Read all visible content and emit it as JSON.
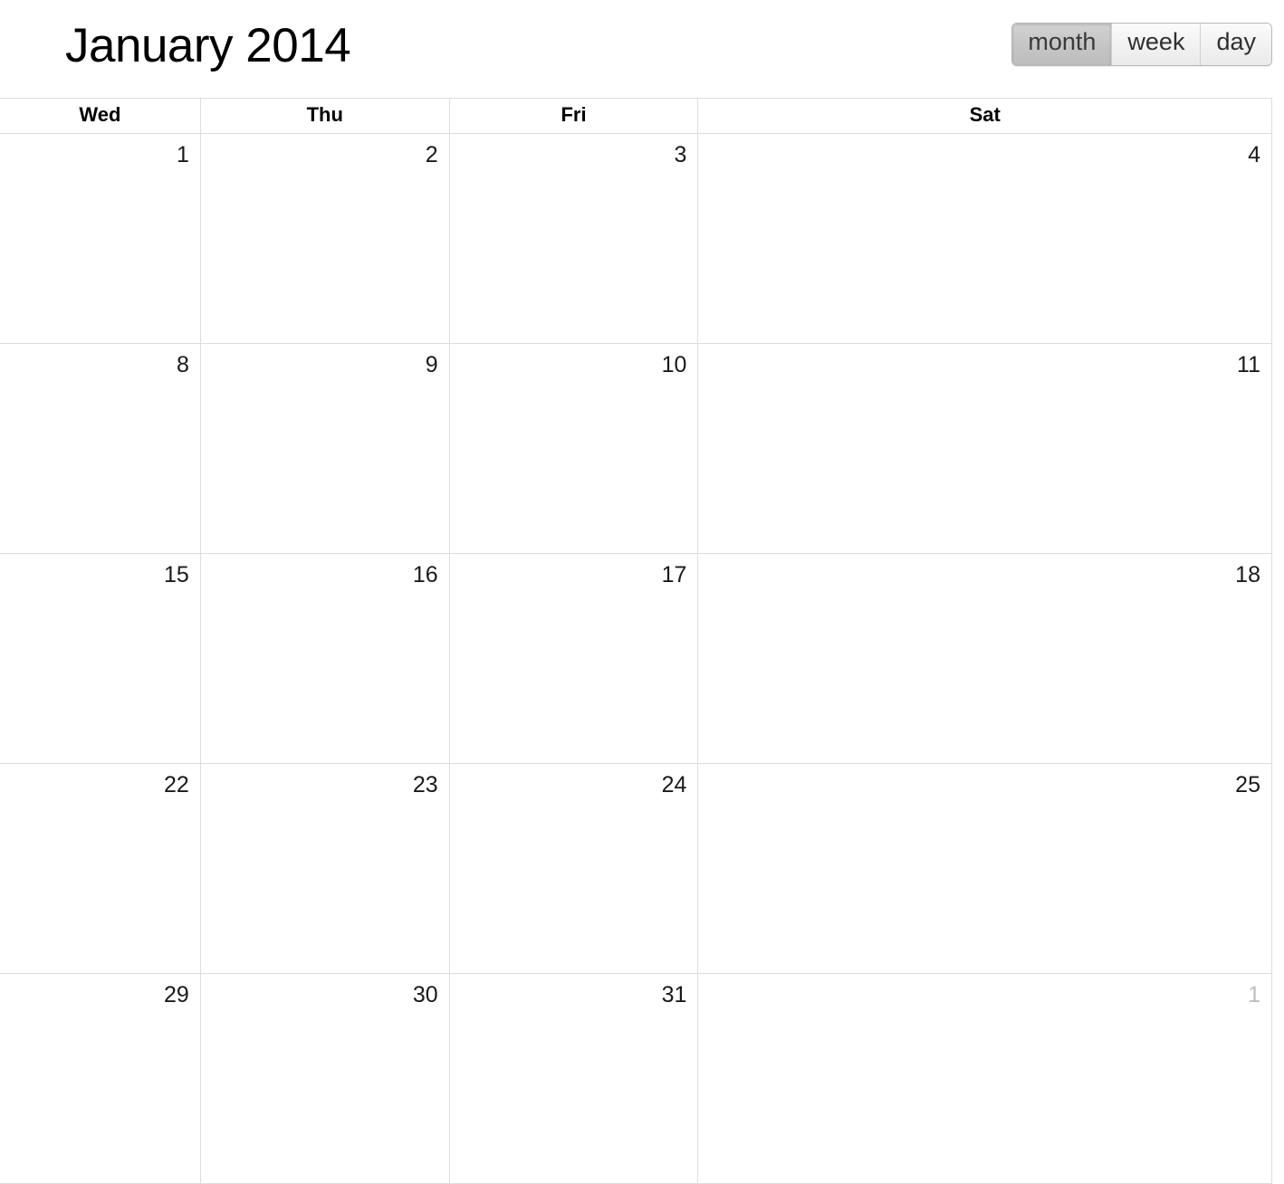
{
  "header": {
    "title": "January 2014"
  },
  "view_switcher": {
    "buttons": [
      {
        "label": "month",
        "active": true
      },
      {
        "label": "week",
        "active": false
      },
      {
        "label": "day",
        "active": false
      }
    ]
  },
  "calendar": {
    "columns": [
      "Wed",
      "Thu",
      "Fri",
      "Sat"
    ],
    "weeks": [
      [
        {
          "day": "1",
          "other_month": false
        },
        {
          "day": "2",
          "other_month": false
        },
        {
          "day": "3",
          "other_month": false
        },
        {
          "day": "4",
          "other_month": false
        }
      ],
      [
        {
          "day": "8",
          "other_month": false
        },
        {
          "day": "9",
          "other_month": false
        },
        {
          "day": "10",
          "other_month": false
        },
        {
          "day": "11",
          "other_month": false
        }
      ],
      [
        {
          "day": "15",
          "other_month": false
        },
        {
          "day": "16",
          "other_month": false
        },
        {
          "day": "17",
          "other_month": false
        },
        {
          "day": "18",
          "other_month": false
        }
      ],
      [
        {
          "day": "22",
          "other_month": false
        },
        {
          "day": "23",
          "other_month": false
        },
        {
          "day": "24",
          "other_month": false
        },
        {
          "day": "25",
          "other_month": false
        }
      ],
      [
        {
          "day": "29",
          "other_month": false
        },
        {
          "day": "30",
          "other_month": false
        },
        {
          "day": "31",
          "other_month": false
        },
        {
          "day": "1",
          "other_month": true
        }
      ]
    ]
  },
  "colors": {
    "grid_line": "#dddddd",
    "text": "#1a1a1a",
    "muted_text": "#bcbcbc",
    "active_button_bg": "#c6c6c6",
    "button_bg": "#f1f1f1"
  }
}
